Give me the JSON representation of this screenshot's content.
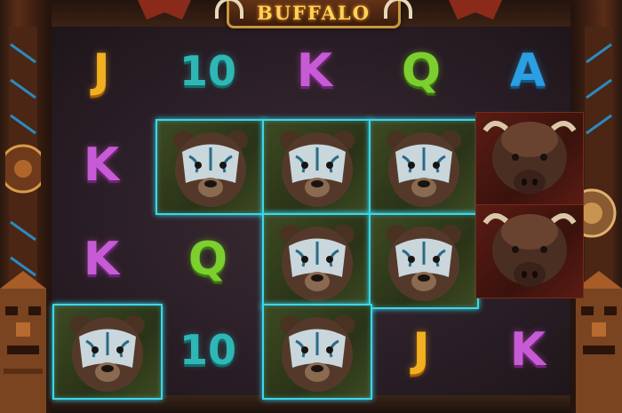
{
  "game": {
    "title": "BUFFALO"
  },
  "colors": {
    "J": "#f2b021",
    "10": "#2fb7b5",
    "K": "#c75bd6",
    "Q": "#7ccf2e",
    "A": "#2c9ee2",
    "wild_border": "#3fd6e6"
  },
  "reels": {
    "row0": [
      {
        "label": "J",
        "type": "letter"
      },
      {
        "label": "10",
        "type": "letter"
      },
      {
        "label": "K",
        "type": "letter"
      },
      {
        "label": "Q",
        "type": "letter"
      },
      {
        "label": "A",
        "type": "letter"
      }
    ],
    "row1": [
      {
        "label": "K",
        "type": "letter"
      },
      {
        "type": "bear"
      },
      {
        "type": "bear"
      },
      {
        "type": "bear"
      },
      {
        "type": "buffalo"
      }
    ],
    "row2": [
      {
        "label": "K",
        "type": "letter"
      },
      {
        "label": "Q",
        "type": "letter"
      },
      {
        "type": "bear"
      },
      {
        "type": "bear"
      },
      {
        "type": "buffalo"
      }
    ],
    "row3": [
      {
        "type": "bear"
      },
      {
        "label": "10",
        "type": "letter"
      },
      {
        "type": "bear"
      },
      {
        "label": "J",
        "type": "letter"
      },
      {
        "label": "K",
        "type": "letter"
      }
    ]
  }
}
